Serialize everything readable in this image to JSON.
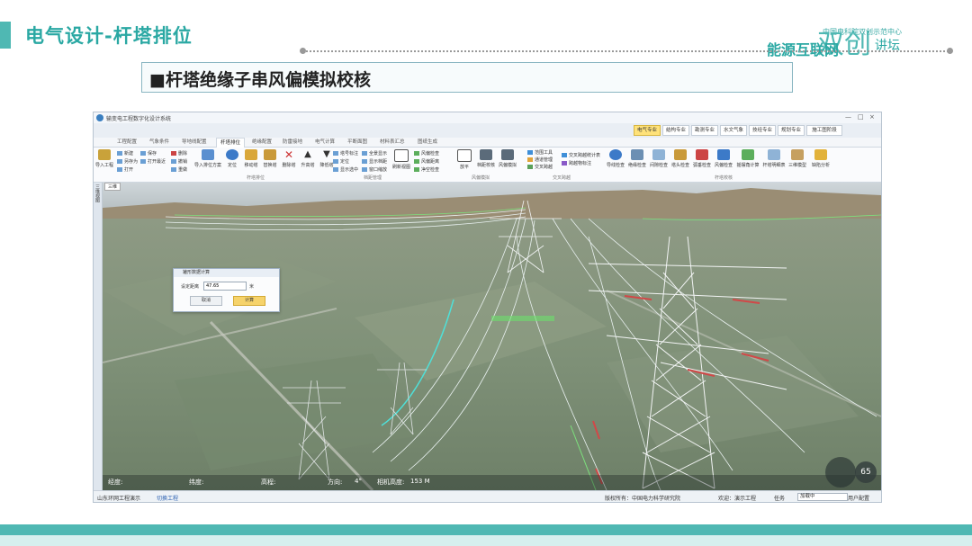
{
  "slide": {
    "title": "电气设计-杆塔排位",
    "subtitle": "■杆塔绝缘子串风偏模拟校核",
    "brand_small": "中国电科院双创示范中心",
    "brand_main": "能源互联网",
    "brand_big": "双创",
    "brand_tail": "讲坛"
  },
  "app": {
    "window_title": "输变电工程数字化设计系统",
    "window_buttons": [
      "—",
      "□",
      "×"
    ],
    "mode_buttons": [
      "电气专业",
      "结构专业",
      "勘测专业",
      "水文气象",
      "技经专业",
      "规划专业",
      "施工图阶段"
    ],
    "tabs": [
      "工程配置",
      "气象条件",
      "导地线配置",
      "杆塔排位",
      "绝缘配置",
      "防雷接地",
      "电气计算",
      "平断面图",
      "材料表汇总",
      "图纸生成"
    ],
    "ribbon": {
      "file_group": [
        "导入工程",
        "新建",
        "另存为",
        "打开",
        "保存",
        "打开最近",
        "删除",
        "撤销",
        "重做"
      ],
      "big_buttons": [
        "导入排位方案",
        "定位",
        "移动塔",
        "替换塔",
        "删除塔",
        "升高塔",
        "降低塔"
      ],
      "mid_small": [
        "塔号标注",
        "全景显示",
        "定位",
        "显示档距",
        "显示选中",
        "窗口缩放",
        "切换档距"
      ],
      "mid_big": [
        "刷新视图"
      ],
      "cross_small": [
        "风偏检查",
        "风偏距离",
        "净空检查"
      ],
      "cross_big": [
        "放平",
        "档距校核",
        "风偏模拟"
      ],
      "cross_small2": [
        "范围工具",
        "通道管理",
        "交叉跨越",
        "交叉跨越统计表",
        "跨越物标注"
      ],
      "right_big": [
        "导线检查",
        "绝缘检查",
        "间隙检查",
        "塔头检查",
        "弧垂检查",
        "风偏检查",
        "摇摆角计算",
        "杆塔明细表",
        "三维模型",
        "缺陷分析"
      ],
      "group_labels": [
        "杆塔排位",
        "档距管理",
        "风偏模拟",
        "交叉跨越",
        "杆塔校核"
      ]
    },
    "side_tab": "三维视图",
    "viewport_tab": "三维",
    "hud": {
      "longitude_label": "经度:",
      "latitude_label": "纬度:",
      "elevation_label": "高程:",
      "heading_label": "方向:",
      "heading_value": "4°",
      "camera_label": "相机高度:",
      "camera_value": "153 M",
      "zoom": "65"
    },
    "dialog": {
      "title": "地形数据计算",
      "label": "设定距离",
      "value": "47.65",
      "unit": "米",
      "cancel": "取消",
      "confirm": "计算"
    },
    "statusbar": {
      "project": "山东环网工程演示",
      "switch": "切换工程",
      "copyright": "版权所有：中国电力科学研究院",
      "user": "欢迎：演示工程",
      "status_label": "任务",
      "status_value": "加载中",
      "user_config": "用户配置"
    }
  }
}
